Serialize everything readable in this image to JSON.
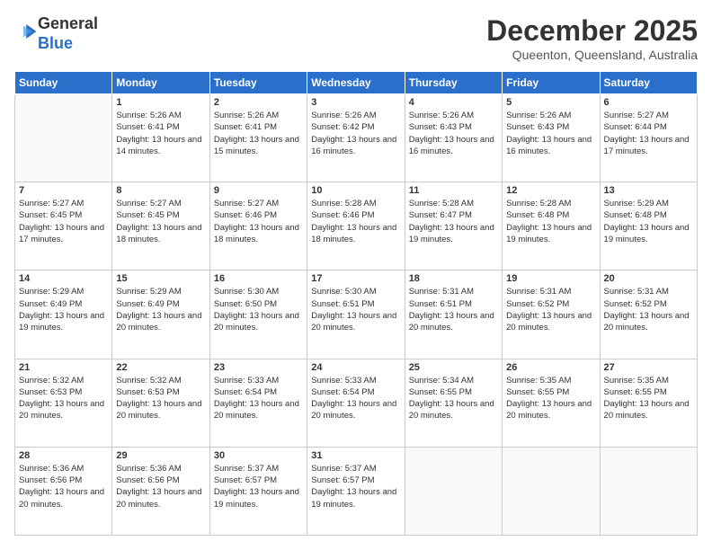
{
  "logo": {
    "general": "General",
    "blue": "Blue"
  },
  "header": {
    "month": "December 2025",
    "location": "Queenton, Queensland, Australia"
  },
  "weekdays": [
    "Sunday",
    "Monday",
    "Tuesday",
    "Wednesday",
    "Thursday",
    "Friday",
    "Saturday"
  ],
  "weeks": [
    [
      {
        "day": "",
        "sunrise": "",
        "sunset": "",
        "daylight": ""
      },
      {
        "day": "1",
        "sunrise": "Sunrise: 5:26 AM",
        "sunset": "Sunset: 6:41 PM",
        "daylight": "Daylight: 13 hours and 14 minutes."
      },
      {
        "day": "2",
        "sunrise": "Sunrise: 5:26 AM",
        "sunset": "Sunset: 6:41 PM",
        "daylight": "Daylight: 13 hours and 15 minutes."
      },
      {
        "day": "3",
        "sunrise": "Sunrise: 5:26 AM",
        "sunset": "Sunset: 6:42 PM",
        "daylight": "Daylight: 13 hours and 16 minutes."
      },
      {
        "day": "4",
        "sunrise": "Sunrise: 5:26 AM",
        "sunset": "Sunset: 6:43 PM",
        "daylight": "Daylight: 13 hours and 16 minutes."
      },
      {
        "day": "5",
        "sunrise": "Sunrise: 5:26 AM",
        "sunset": "Sunset: 6:43 PM",
        "daylight": "Daylight: 13 hours and 16 minutes."
      },
      {
        "day": "6",
        "sunrise": "Sunrise: 5:27 AM",
        "sunset": "Sunset: 6:44 PM",
        "daylight": "Daylight: 13 hours and 17 minutes."
      }
    ],
    [
      {
        "day": "7",
        "sunrise": "Sunrise: 5:27 AM",
        "sunset": "Sunset: 6:45 PM",
        "daylight": "Daylight: 13 hours and 17 minutes."
      },
      {
        "day": "8",
        "sunrise": "Sunrise: 5:27 AM",
        "sunset": "Sunset: 6:45 PM",
        "daylight": "Daylight: 13 hours and 18 minutes."
      },
      {
        "day": "9",
        "sunrise": "Sunrise: 5:27 AM",
        "sunset": "Sunset: 6:46 PM",
        "daylight": "Daylight: 13 hours and 18 minutes."
      },
      {
        "day": "10",
        "sunrise": "Sunrise: 5:28 AM",
        "sunset": "Sunset: 6:46 PM",
        "daylight": "Daylight: 13 hours and 18 minutes."
      },
      {
        "day": "11",
        "sunrise": "Sunrise: 5:28 AM",
        "sunset": "Sunset: 6:47 PM",
        "daylight": "Daylight: 13 hours and 19 minutes."
      },
      {
        "day": "12",
        "sunrise": "Sunrise: 5:28 AM",
        "sunset": "Sunset: 6:48 PM",
        "daylight": "Daylight: 13 hours and 19 minutes."
      },
      {
        "day": "13",
        "sunrise": "Sunrise: 5:29 AM",
        "sunset": "Sunset: 6:48 PM",
        "daylight": "Daylight: 13 hours and 19 minutes."
      }
    ],
    [
      {
        "day": "14",
        "sunrise": "Sunrise: 5:29 AM",
        "sunset": "Sunset: 6:49 PM",
        "daylight": "Daylight: 13 hours and 19 minutes."
      },
      {
        "day": "15",
        "sunrise": "Sunrise: 5:29 AM",
        "sunset": "Sunset: 6:49 PM",
        "daylight": "Daylight: 13 hours and 20 minutes."
      },
      {
        "day": "16",
        "sunrise": "Sunrise: 5:30 AM",
        "sunset": "Sunset: 6:50 PM",
        "daylight": "Daylight: 13 hours and 20 minutes."
      },
      {
        "day": "17",
        "sunrise": "Sunrise: 5:30 AM",
        "sunset": "Sunset: 6:51 PM",
        "daylight": "Daylight: 13 hours and 20 minutes."
      },
      {
        "day": "18",
        "sunrise": "Sunrise: 5:31 AM",
        "sunset": "Sunset: 6:51 PM",
        "daylight": "Daylight: 13 hours and 20 minutes."
      },
      {
        "day": "19",
        "sunrise": "Sunrise: 5:31 AM",
        "sunset": "Sunset: 6:52 PM",
        "daylight": "Daylight: 13 hours and 20 minutes."
      },
      {
        "day": "20",
        "sunrise": "Sunrise: 5:31 AM",
        "sunset": "Sunset: 6:52 PM",
        "daylight": "Daylight: 13 hours and 20 minutes."
      }
    ],
    [
      {
        "day": "21",
        "sunrise": "Sunrise: 5:32 AM",
        "sunset": "Sunset: 6:53 PM",
        "daylight": "Daylight: 13 hours and 20 minutes."
      },
      {
        "day": "22",
        "sunrise": "Sunrise: 5:32 AM",
        "sunset": "Sunset: 6:53 PM",
        "daylight": "Daylight: 13 hours and 20 minutes."
      },
      {
        "day": "23",
        "sunrise": "Sunrise: 5:33 AM",
        "sunset": "Sunset: 6:54 PM",
        "daylight": "Daylight: 13 hours and 20 minutes."
      },
      {
        "day": "24",
        "sunrise": "Sunrise: 5:33 AM",
        "sunset": "Sunset: 6:54 PM",
        "daylight": "Daylight: 13 hours and 20 minutes."
      },
      {
        "day": "25",
        "sunrise": "Sunrise: 5:34 AM",
        "sunset": "Sunset: 6:55 PM",
        "daylight": "Daylight: 13 hours and 20 minutes."
      },
      {
        "day": "26",
        "sunrise": "Sunrise: 5:35 AM",
        "sunset": "Sunset: 6:55 PM",
        "daylight": "Daylight: 13 hours and 20 minutes."
      },
      {
        "day": "27",
        "sunrise": "Sunrise: 5:35 AM",
        "sunset": "Sunset: 6:55 PM",
        "daylight": "Daylight: 13 hours and 20 minutes."
      }
    ],
    [
      {
        "day": "28",
        "sunrise": "Sunrise: 5:36 AM",
        "sunset": "Sunset: 6:56 PM",
        "daylight": "Daylight: 13 hours and 20 minutes."
      },
      {
        "day": "29",
        "sunrise": "Sunrise: 5:36 AM",
        "sunset": "Sunset: 6:56 PM",
        "daylight": "Daylight: 13 hours and 20 minutes."
      },
      {
        "day": "30",
        "sunrise": "Sunrise: 5:37 AM",
        "sunset": "Sunset: 6:57 PM",
        "daylight": "Daylight: 13 hours and 19 minutes."
      },
      {
        "day": "31",
        "sunrise": "Sunrise: 5:37 AM",
        "sunset": "Sunset: 6:57 PM",
        "daylight": "Daylight: 13 hours and 19 minutes."
      },
      {
        "day": "",
        "sunrise": "",
        "sunset": "",
        "daylight": ""
      },
      {
        "day": "",
        "sunrise": "",
        "sunset": "",
        "daylight": ""
      },
      {
        "day": "",
        "sunrise": "",
        "sunset": "",
        "daylight": ""
      }
    ]
  ]
}
